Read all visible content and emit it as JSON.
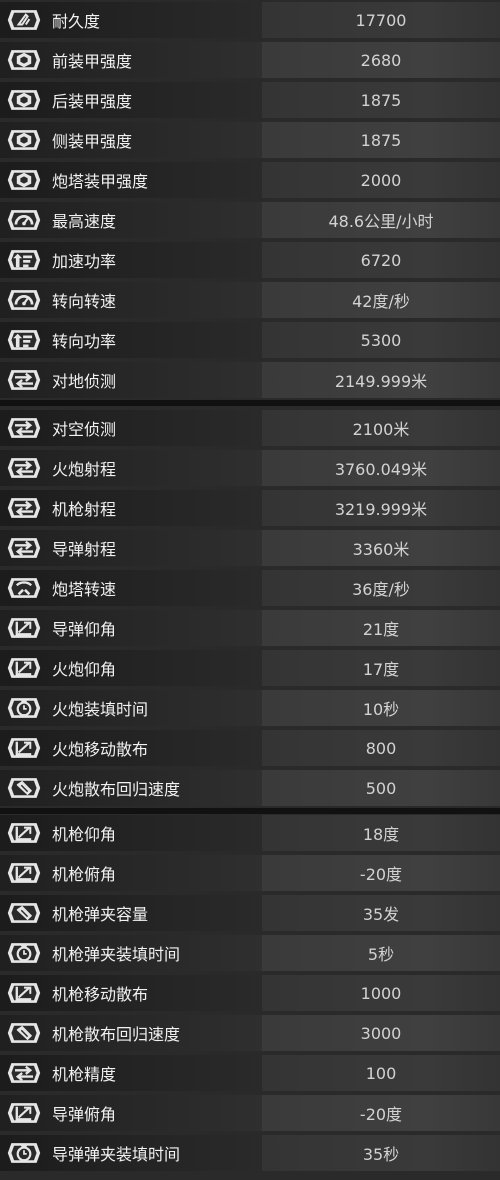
{
  "stats": [
    {
      "label": "耐久度",
      "value": "17700",
      "icon": "durability-icon"
    },
    {
      "label": "前装甲强度",
      "value": "2680",
      "icon": "armor-icon"
    },
    {
      "label": "后装甲强度",
      "value": "1875",
      "icon": "armor-icon"
    },
    {
      "label": "侧装甲强度",
      "value": "1875",
      "icon": "armor-icon"
    },
    {
      "label": "炮塔装甲强度",
      "value": "2000",
      "icon": "armor-icon"
    },
    {
      "label": "最高速度",
      "value": "48.6公里/小时",
      "icon": "speedometer-icon"
    },
    {
      "label": "加速功率",
      "value": "6720",
      "icon": "power-icon"
    },
    {
      "label": "转向转速",
      "value": "42度/秒",
      "icon": "speedometer-icon"
    },
    {
      "label": "转向功率",
      "value": "5300",
      "icon": "power-icon"
    },
    {
      "label": "对地侦测",
      "value": "2149.999米",
      "icon": "range-icon"
    },
    {
      "label": "对空侦测",
      "value": "2100米",
      "icon": "range-icon"
    },
    {
      "label": "火炮射程",
      "value": "3760.049米",
      "icon": "range-icon"
    },
    {
      "label": "机枪射程",
      "value": "3219.999米",
      "icon": "range-icon"
    },
    {
      "label": "导弹射程",
      "value": "3360米",
      "icon": "range-icon"
    },
    {
      "label": "炮塔转速",
      "value": "36度/秒",
      "icon": "turret-rotation-icon"
    },
    {
      "label": "导弹仰角",
      "value": "21度",
      "icon": "angle-icon"
    },
    {
      "label": "火炮仰角",
      "value": "17度",
      "icon": "angle-icon"
    },
    {
      "label": "火炮装填时间",
      "value": "10秒",
      "icon": "timer-icon"
    },
    {
      "label": "火炮移动散布",
      "value": "800",
      "icon": "angle-icon"
    },
    {
      "label": "火炮散布回归速度",
      "value": "500",
      "icon": "shell-icon"
    },
    {
      "label": "机枪仰角",
      "value": "18度",
      "icon": "angle-icon"
    },
    {
      "label": "机枪俯角",
      "value": "-20度",
      "icon": "angle-icon"
    },
    {
      "label": "机枪弹夹容量",
      "value": "35发",
      "icon": "shell-icon"
    },
    {
      "label": "机枪弹夹装填时间",
      "value": "5秒",
      "icon": "timer-icon"
    },
    {
      "label": "机枪移动散布",
      "value": "1000",
      "icon": "angle-icon"
    },
    {
      "label": "机枪散布回归速度",
      "value": "3000",
      "icon": "shell-icon"
    },
    {
      "label": "机枪精度",
      "value": "100",
      "icon": "range-icon"
    },
    {
      "label": "导弹俯角",
      "value": "-20度",
      "icon": "angle-icon"
    },
    {
      "label": "导弹弹夹装填时间",
      "value": "35秒",
      "icon": "timer-icon"
    }
  ]
}
